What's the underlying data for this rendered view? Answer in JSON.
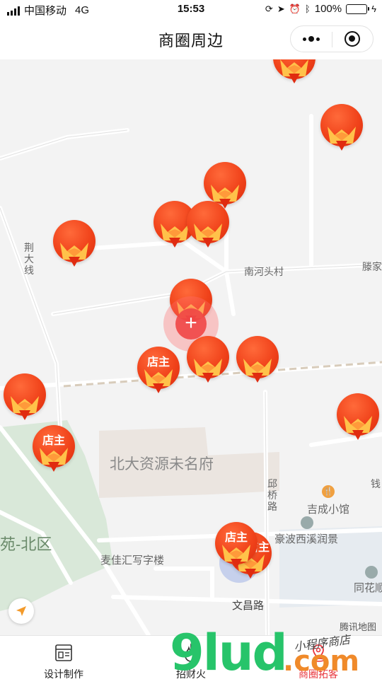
{
  "status_bar": {
    "carrier": "中国移动",
    "network": "4G",
    "time": "15:53",
    "battery": "100%"
  },
  "nav": {
    "title": "商圈周边"
  },
  "map": {
    "labels": {
      "jingda_xian": "荆\n大\n线",
      "nanhe_tou_cun": "南河头村",
      "teng_jia": "滕家",
      "beida_ziyuan": "北大资源未名府",
      "qiu_qiao_lu": "邱\n桥\n路",
      "qian": "钱",
      "jicheng_xiaoguan": "吉成小馆",
      "yuan_bei_qu": "苑-北区",
      "haobo_xixi": "豪波西溪润景",
      "maijia_xiezilou": "麦佳汇写字楼",
      "tonghua": "同花顺",
      "wenchang_lu": "文昌路"
    },
    "owner_label": "店主",
    "attribution": "腾讯地图",
    "colors": {
      "pin": "#f0421a",
      "center": "#f04646"
    }
  },
  "tabs": [
    {
      "label": "设计制作",
      "icon": "layout-icon"
    },
    {
      "label": "招财火",
      "icon": "fire-icon"
    },
    {
      "label": "商圈拓客",
      "icon": "location-pin-icon",
      "active": true
    }
  ],
  "watermark": {
    "main": "9lud",
    "suffix": ".com",
    "handwriting": "小程序商店"
  }
}
